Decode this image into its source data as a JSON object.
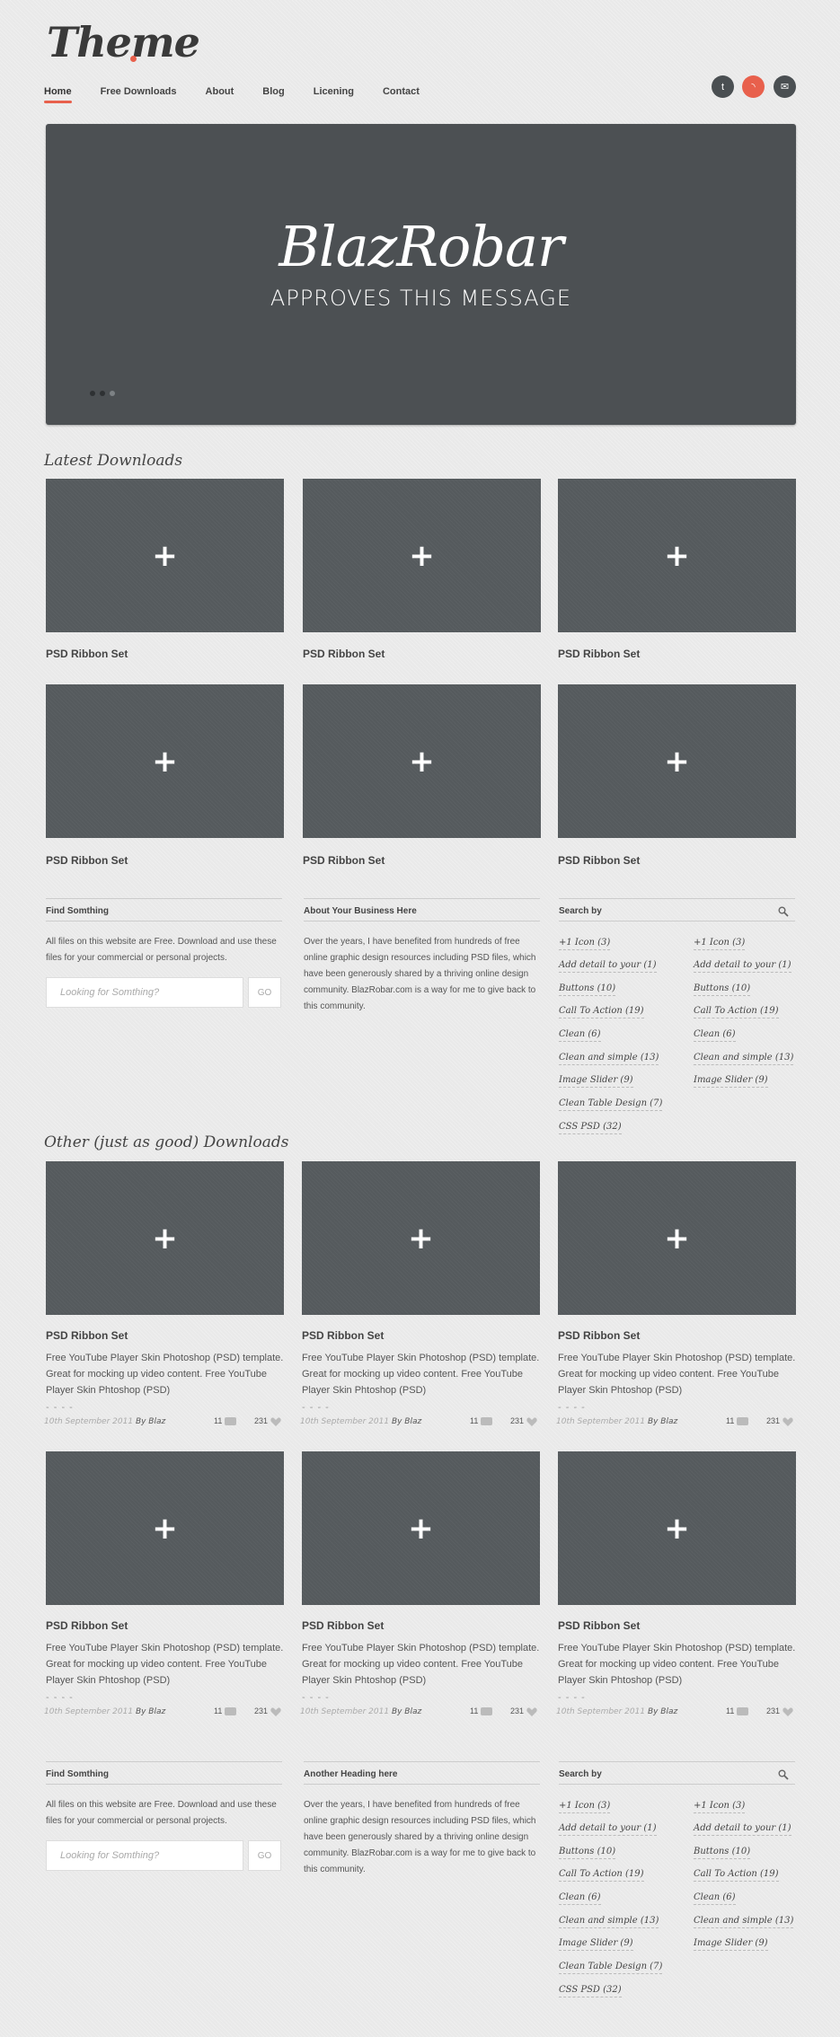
{
  "logo": "Theme",
  "nav": [
    "Home",
    "Free Downloads",
    "About",
    "Blog",
    "Licening",
    "Contact"
  ],
  "social": [
    {
      "icon": "twitter-icon",
      "glyph": "t"
    },
    {
      "icon": "rss-icon",
      "glyph": "◝"
    },
    {
      "icon": "mail-icon",
      "glyph": "✉"
    }
  ],
  "hero": {
    "title": "BlazRobar",
    "subtitle": "APPROVES THIS MESSAGE"
  },
  "latest": {
    "title": "Latest Downloads",
    "item_title": "PSD Ribbon Set"
  },
  "widgets1": {
    "find_title": "Find Somthing",
    "find_text": "All files on this website are Free. Download and use these files for your commercial or personal projects.",
    "search_placeholder": "Looking for Somthing?",
    "go": "GO",
    "about_title": "About Your Business Here",
    "about_text": "Over the years, I have benefited from hundreds of free online graphic design resources including PSD files, which have been generously shared by a thriving online design community. BlazRobar.com is a way for me to give back to this community.",
    "search_title": "Search by"
  },
  "tags_left": [
    "+1 Icon (3)",
    "Add detail to your (1)",
    "Buttons (10)",
    "Call To Action (19)",
    "Clean (6)",
    "Clean and simple (13)",
    "Image Slider (9)",
    "Clean Table Design (7)",
    "CSS  PSD (32)"
  ],
  "tags_right": [
    "+1 Icon (3)",
    "Add detail to your (1)",
    "Buttons (10)",
    "Call To Action (19)",
    "Clean (6)",
    "Clean and simple (13)",
    "Image Slider (9)"
  ],
  "other": {
    "title": "Other (just as good) Downloads",
    "item_title": "PSD Ribbon Set",
    "item_desc": "Free YouTube Player Skin Photoshop (PSD) template. Great for mocking up video content. Free YouTube Player Skin Phtoshop (PSD)",
    "dashes": "- - - -",
    "date": "10th September 2011",
    "by": "By Blaz",
    "comments": "11",
    "likes": "231"
  },
  "widgets2": {
    "find_title": "Find Somthing",
    "find_text": "All files on this website are Free. Download and use these files for your commercial or personal projects.",
    "search_placeholder": "Looking for Somthing?",
    "go": "GO",
    "about_title": "Another Heading here",
    "about_text": "Over the years, I have benefited from hundreds of free online graphic design resources including PSD files, which have been generously shared by a thriving online design community. BlazRobar.com is a way for me to give back to this community.",
    "search_title": "Search by"
  }
}
